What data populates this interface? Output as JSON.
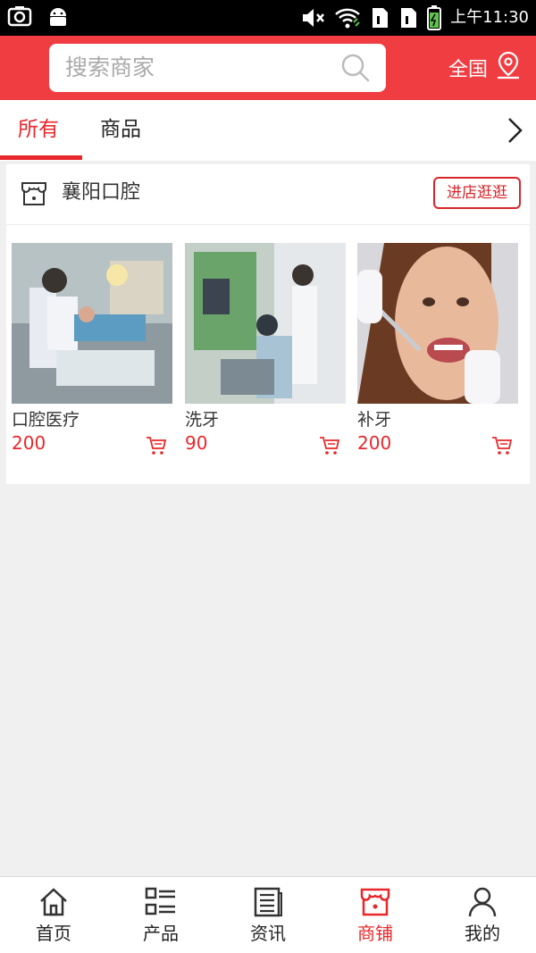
{
  "status_bar": {
    "time": "上午11:30"
  },
  "header": {
    "search_placeholder": "搜索商家",
    "region_label": "全国"
  },
  "tabs": [
    {
      "label": "所有",
      "active": true
    },
    {
      "label": "商品",
      "active": false
    }
  ],
  "shop": {
    "name": "襄阳口腔",
    "visit_label": "进店逛逛",
    "products": [
      {
        "name": "口腔医疗",
        "price": "200"
      },
      {
        "name": "洗牙",
        "price": "90"
      },
      {
        "name": "补牙",
        "price": "200"
      }
    ]
  },
  "bottom_nav": [
    {
      "label": "首页",
      "icon": "home-icon",
      "active": false
    },
    {
      "label": "产品",
      "icon": "list-icon",
      "active": false
    },
    {
      "label": "资讯",
      "icon": "news-icon",
      "active": false
    },
    {
      "label": "商铺",
      "icon": "store-icon",
      "active": true
    },
    {
      "label": "我的",
      "icon": "user-icon",
      "active": false
    }
  ],
  "colors": {
    "accent": "#ef3d42",
    "price": "#e8272b"
  }
}
